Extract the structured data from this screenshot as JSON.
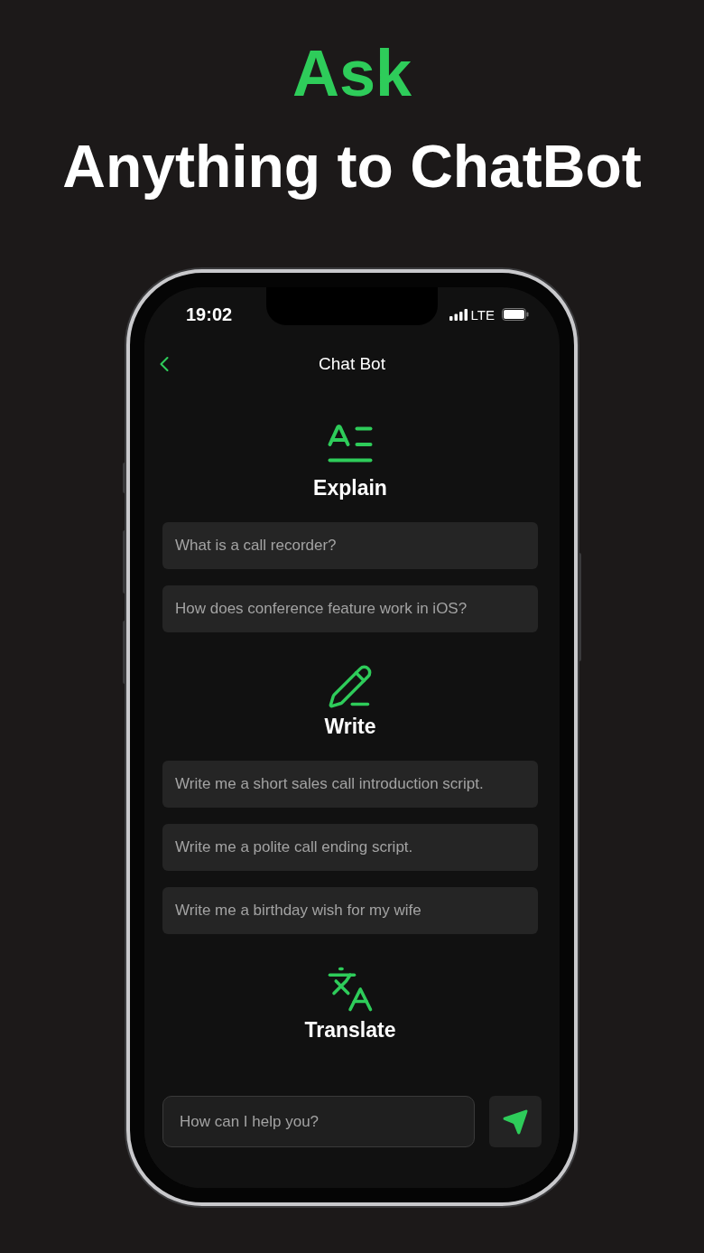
{
  "headline": {
    "accent": "Ask",
    "title": "Anything to ChatBot"
  },
  "status_bar": {
    "time": "19:02",
    "network": "LTE"
  },
  "nav": {
    "title": "Chat Bot"
  },
  "sections": [
    {
      "kind": "explain",
      "title": "Explain",
      "prompts": [
        "What is a call recorder?",
        "How does conference feature work in iOS?"
      ]
    },
    {
      "kind": "write",
      "title": "Write",
      "prompts": [
        "Write me a short sales call introduction script.",
        "Write me a polite call ending script.",
        "Write me a birthday wish for my wife"
      ]
    },
    {
      "kind": "translate",
      "title": "Translate"
    }
  ],
  "composer": {
    "placeholder": "How can I help you?"
  }
}
